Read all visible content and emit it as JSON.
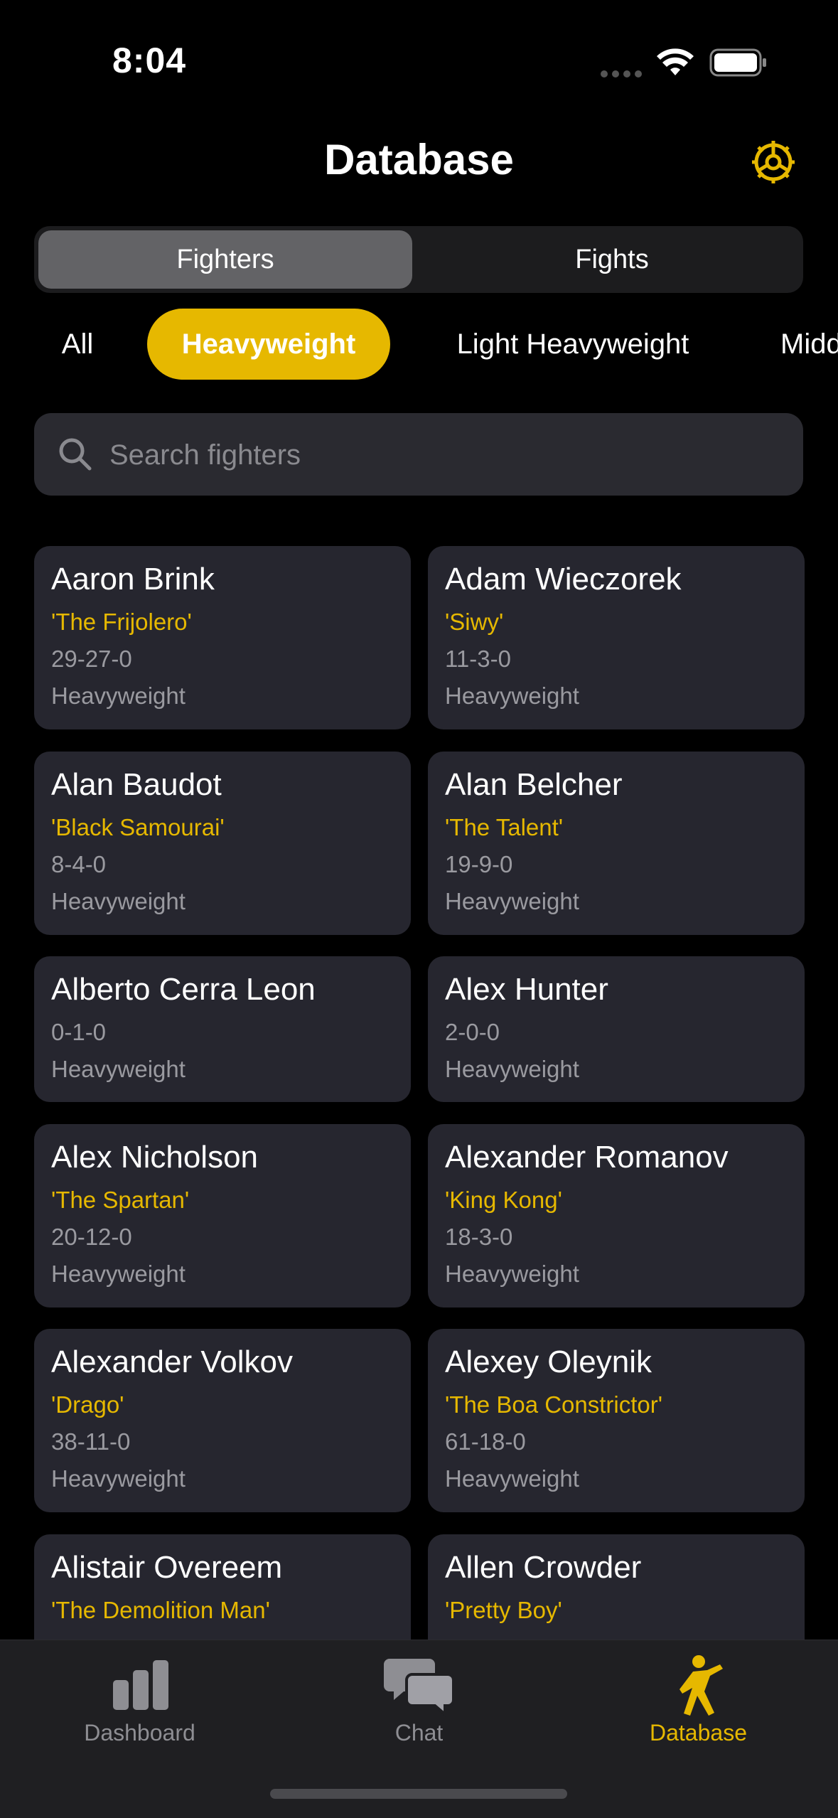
{
  "status_bar": {
    "time": "8:04"
  },
  "header": {
    "title": "Database"
  },
  "segments": {
    "fighters": "Fighters",
    "fights": "Fights"
  },
  "filters": [
    "All",
    "Heavyweight",
    "Light Heavyweight",
    "Midd"
  ],
  "search": {
    "placeholder": "Search fighters"
  },
  "fighters": [
    {
      "name": "Aaron Brink",
      "nickname": "'The Frijolero'",
      "record": "29-27-0",
      "division": "Heavyweight"
    },
    {
      "name": "Adam Wieczorek",
      "nickname": "'Siwy'",
      "record": "11-3-0",
      "division": "Heavyweight"
    },
    {
      "name": "Alan Baudot",
      "nickname": "'Black Samourai'",
      "record": "8-4-0",
      "division": "Heavyweight"
    },
    {
      "name": "Alan Belcher",
      "nickname": "'The Talent'",
      "record": "19-9-0",
      "division": "Heavyweight"
    },
    {
      "name": "Alberto Cerra Leon",
      "nickname": "",
      "record": "0-1-0",
      "division": "Heavyweight"
    },
    {
      "name": "Alex Hunter",
      "nickname": "",
      "record": "2-0-0",
      "division": "Heavyweight"
    },
    {
      "name": "Alex Nicholson",
      "nickname": "'The Spartan'",
      "record": "20-12-0",
      "division": "Heavyweight"
    },
    {
      "name": "Alexander Romanov",
      "nickname": "'King Kong'",
      "record": "18-3-0",
      "division": "Heavyweight"
    },
    {
      "name": "Alexander Volkov",
      "nickname": "'Drago'",
      "record": "38-11-0",
      "division": "Heavyweight"
    },
    {
      "name": "Alexey Oleynik",
      "nickname": "'The Boa Constrictor'",
      "record": "61-18-0",
      "division": "Heavyweight"
    },
    {
      "name": "Alistair Overeem",
      "nickname": "'The Demolition Man'",
      "record": "",
      "division": ""
    },
    {
      "name": "Allen Crowder",
      "nickname": "'Pretty Boy'",
      "record": "",
      "division": ""
    }
  ],
  "tabs": [
    {
      "label": "Dashboard",
      "icon": "bar-chart-icon"
    },
    {
      "label": "Chat",
      "icon": "chat-bubbles-icon"
    },
    {
      "label": "Database",
      "icon": "fighter-icon"
    }
  ],
  "colors": {
    "accent": "#e6b800",
    "card": "#26262f",
    "background": "#000000"
  }
}
